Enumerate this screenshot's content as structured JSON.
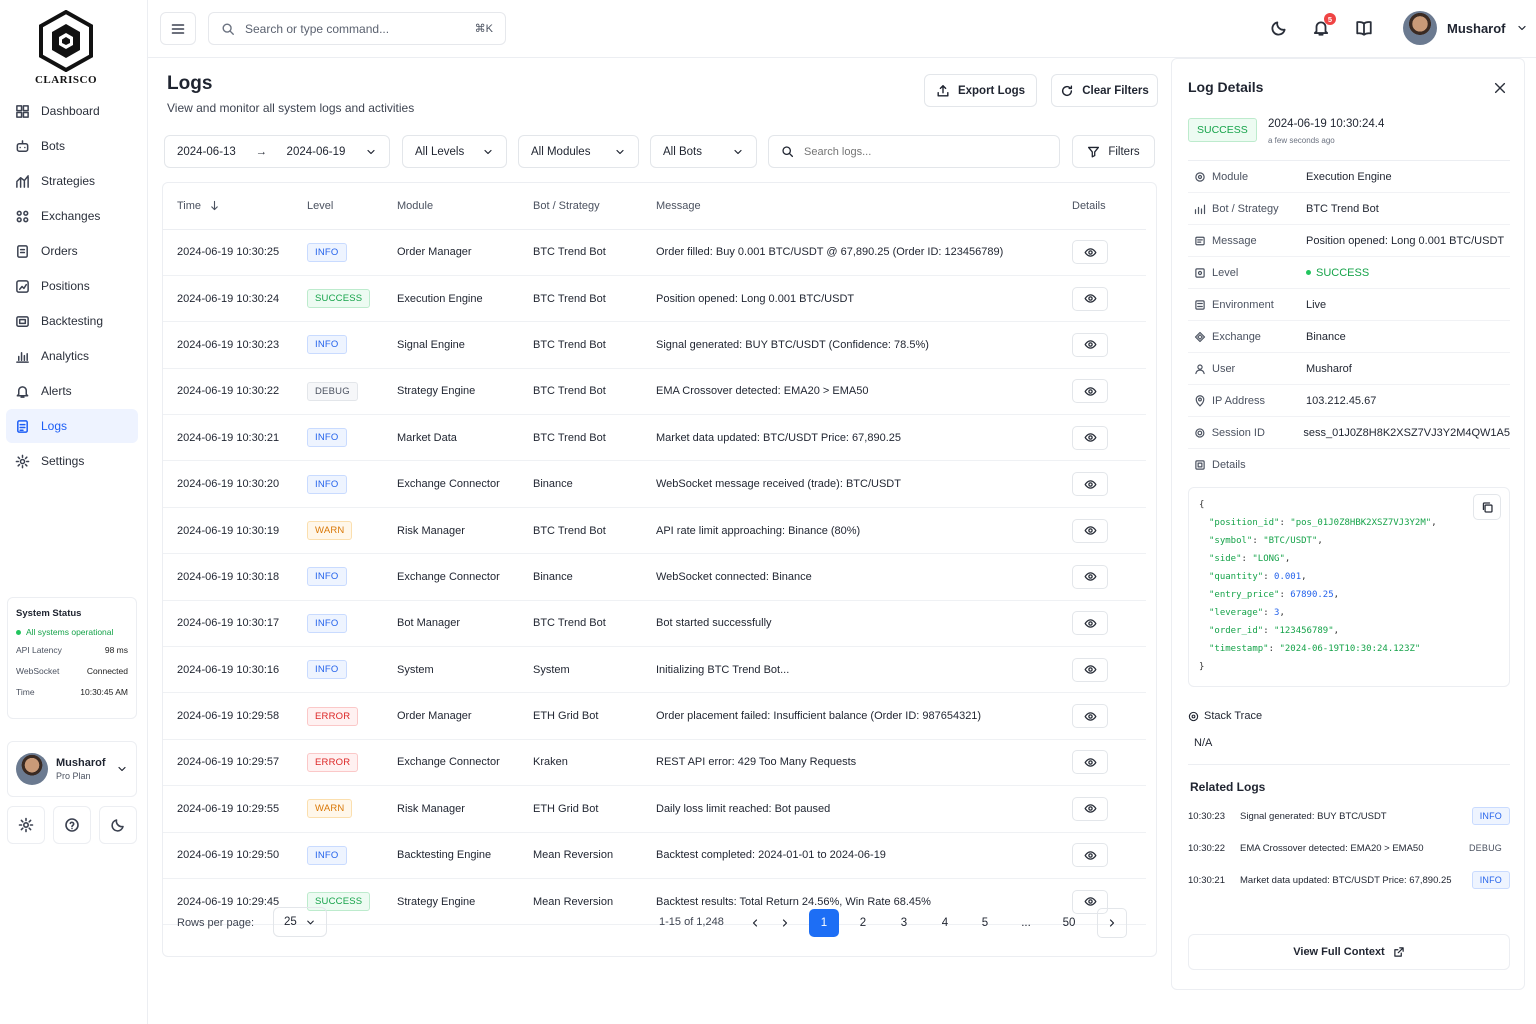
{
  "brand": {
    "name": "CLARISCO"
  },
  "sidebar": {
    "items": [
      {
        "label": "Dashboard",
        "icon": "dashboard-icon"
      },
      {
        "label": "Bots",
        "icon": "bot-icon"
      },
      {
        "label": "Strategies",
        "icon": "strategy-icon"
      },
      {
        "label": "Exchanges",
        "icon": "exchange-icon"
      },
      {
        "label": "Orders",
        "icon": "orders-icon"
      },
      {
        "label": "Positions",
        "icon": "positions-icon"
      },
      {
        "label": "Backtesting",
        "icon": "backtesting-icon"
      },
      {
        "label": "Analytics",
        "icon": "analytics-icon"
      },
      {
        "label": "Alerts",
        "icon": "bell-icon"
      },
      {
        "label": "Logs",
        "icon": "logs-icon",
        "active": true
      },
      {
        "label": "Settings",
        "icon": "gear-icon"
      }
    ],
    "status": {
      "title": "System Status",
      "state": "All systems operational",
      "rows": [
        {
          "label": "API Latency",
          "value": "98 ms"
        },
        {
          "label": "WebSocket",
          "value": "Connected"
        },
        {
          "label": "Time",
          "value": "10:30:45 AM"
        }
      ]
    },
    "user": {
      "name": "Musharof",
      "plan": "Pro Plan"
    }
  },
  "topbar": {
    "search_placeholder": "Search or type command...",
    "shortcut": "⌘K",
    "notification_count": "5",
    "user_name": "Musharof"
  },
  "page": {
    "title": "Logs",
    "subtitle": "View and monitor all system logs and activities",
    "export_label": "Export Logs",
    "clear_label": "Clear Filters"
  },
  "filters": {
    "date_from": "2024-06-13",
    "date_arrow": "→",
    "date_to": "2024-06-19",
    "levels": "All Levels",
    "modules": "All Modules",
    "bots": "All Bots",
    "search_placeholder": "Search logs...",
    "filters_label": "Filters"
  },
  "table": {
    "headers": [
      "Time",
      "Level",
      "Module",
      "Bot / Strategy",
      "Message",
      "Details"
    ],
    "rows": [
      {
        "time": "2024-06-19 10:30:25",
        "level": "INFO",
        "module": "Order Manager",
        "bot": "BTC Trend Bot",
        "message": "Order filled: Buy 0.001 BTC/USDT @ 67,890.25 (Order ID: 123456789)"
      },
      {
        "time": "2024-06-19 10:30:24",
        "level": "SUCCESS",
        "module": "Execution Engine",
        "bot": "BTC Trend Bot",
        "message": "Position opened: Long 0.001 BTC/USDT"
      },
      {
        "time": "2024-06-19 10:30:23",
        "level": "INFO",
        "module": "Signal Engine",
        "bot": "BTC Trend Bot",
        "message": "Signal generated: BUY BTC/USDT (Confidence: 78.5%)"
      },
      {
        "time": "2024-06-19 10:30:22",
        "level": "DEBUG",
        "module": "Strategy Engine",
        "bot": "BTC Trend Bot",
        "message": "EMA Crossover detected: EMA20 > EMA50"
      },
      {
        "time": "2024-06-19 10:30:21",
        "level": "INFO",
        "module": "Market Data",
        "bot": "BTC Trend Bot",
        "message": "Market data updated: BTC/USDT Price: 67,890.25"
      },
      {
        "time": "2024-06-19 10:30:20",
        "level": "INFO",
        "module": "Exchange Connector",
        "bot": "Binance",
        "message": "WebSocket message received (trade): BTC/USDT"
      },
      {
        "time": "2024-06-19 10:30:19",
        "level": "WARN",
        "module": "Risk Manager",
        "bot": "BTC Trend Bot",
        "message": "API rate limit approaching: Binance (80%)"
      },
      {
        "time": "2024-06-19 10:30:18",
        "level": "INFO",
        "module": "Exchange Connector",
        "bot": "Binance",
        "message": "WebSocket connected: Binance"
      },
      {
        "time": "2024-06-19 10:30:17",
        "level": "INFO",
        "module": "Bot Manager",
        "bot": "BTC Trend Bot",
        "message": "Bot started successfully"
      },
      {
        "time": "2024-06-19 10:30:16",
        "level": "INFO",
        "module": "System",
        "bot": "System",
        "message": "Initializing BTC Trend Bot..."
      },
      {
        "time": "2024-06-19 10:29:58",
        "level": "ERROR",
        "module": "Order Manager",
        "bot": "ETH Grid Bot",
        "message": "Order placement failed: Insufficient balance (Order ID: 987654321)"
      },
      {
        "time": "2024-06-19 10:29:57",
        "level": "ERROR",
        "module": "Exchange Connector",
        "bot": "Kraken",
        "message": "REST API error: 429 Too Many Requests"
      },
      {
        "time": "2024-06-19 10:29:55",
        "level": "WARN",
        "module": "Risk Manager",
        "bot": "ETH Grid Bot",
        "message": "Daily loss limit reached: Bot paused"
      },
      {
        "time": "2024-06-19 10:29:50",
        "level": "INFO",
        "module": "Backtesting Engine",
        "bot": "Mean Reversion",
        "message": "Backtest completed: 2024-01-01 to 2024-06-19"
      },
      {
        "time": "2024-06-19 10:29:45",
        "level": "SUCCESS",
        "module": "Strategy Engine",
        "bot": "Mean Reversion",
        "message": "Backtest results: Total Return 24.56%, Win Rate 68.45%"
      }
    ]
  },
  "pagination": {
    "rows_label": "Rows per page:",
    "rows_value": "25",
    "range": "1-15 of 1,248",
    "pages": [
      "1",
      "2",
      "3",
      "4",
      "5",
      "...",
      "50"
    ],
    "active": "1"
  },
  "details": {
    "title": "Log Details",
    "level": "SUCCESS",
    "time": "2024-06-19 10:30:24.4",
    "ago": "a few seconds ago",
    "fields": [
      {
        "label": "Module",
        "value": "Execution Engine",
        "icon": "module-icon"
      },
      {
        "label": "Bot / Strategy",
        "value": "BTC Trend Bot",
        "icon": "strategy-icon"
      },
      {
        "label": "Message",
        "value": "Position opened: Long 0.001 BTC/USDT",
        "icon": "message-icon"
      },
      {
        "label": "Level",
        "value": "SUCCESS",
        "icon": "level-icon"
      },
      {
        "label": "Environment",
        "value": "Live",
        "icon": "environment-icon"
      },
      {
        "label": "Exchange",
        "value": "Binance",
        "icon": "exchange-icon"
      },
      {
        "label": "User",
        "value": "Musharof",
        "icon": "user-icon"
      },
      {
        "label": "IP Address",
        "value": "103.212.45.67",
        "icon": "location-icon"
      },
      {
        "label": "Session ID",
        "value": "sess_01J0Z8H8K2XSZ7VJ3Y2M4QW1A5",
        "icon": "session-icon"
      }
    ],
    "details_label": "Details",
    "json": [
      {
        "k": "\"position_id\"",
        "v": "\"pos_01J0Z8HBK2XSZ7VJ3Y2M\"",
        "t": "s"
      },
      {
        "k": "\"symbol\"",
        "v": "\"BTC/USDT\"",
        "t": "s"
      },
      {
        "k": "\"side\"",
        "v": "\"LONG\"",
        "t": "s"
      },
      {
        "k": "\"quantity\"",
        "v": "0.001",
        "t": "n"
      },
      {
        "k": "\"entry_price\"",
        "v": "67890.25",
        "t": "n"
      },
      {
        "k": "\"leverage\"",
        "v": "3",
        "t": "n"
      },
      {
        "k": "\"order_id\"",
        "v": "\"123456789\"",
        "t": "s"
      },
      {
        "k": "\"timestamp\"",
        "v": "\"2024-06-19T10:30:24.123Z\"",
        "t": "s"
      }
    ],
    "stack_label": "Stack Trace",
    "stack_value": "N/A",
    "related_title": "Related Logs",
    "related": [
      {
        "time": "10:30:23",
        "message": "Signal generated: BUY BTC/USDT",
        "level": "INFO"
      },
      {
        "time": "10:30:22",
        "message": "EMA Crossover detected: EMA20 > EMA50",
        "level": "DEBUG"
      },
      {
        "time": "10:30:21",
        "message": "Market data updated: BTC/USDT Price: 67,890.25",
        "level": "INFO"
      }
    ],
    "context_label": "View Full Context"
  },
  "colors": {
    "accent": "#1d6ef5",
    "success": "#16a34a",
    "error": "#dc2626",
    "warn": "#d97706"
  }
}
